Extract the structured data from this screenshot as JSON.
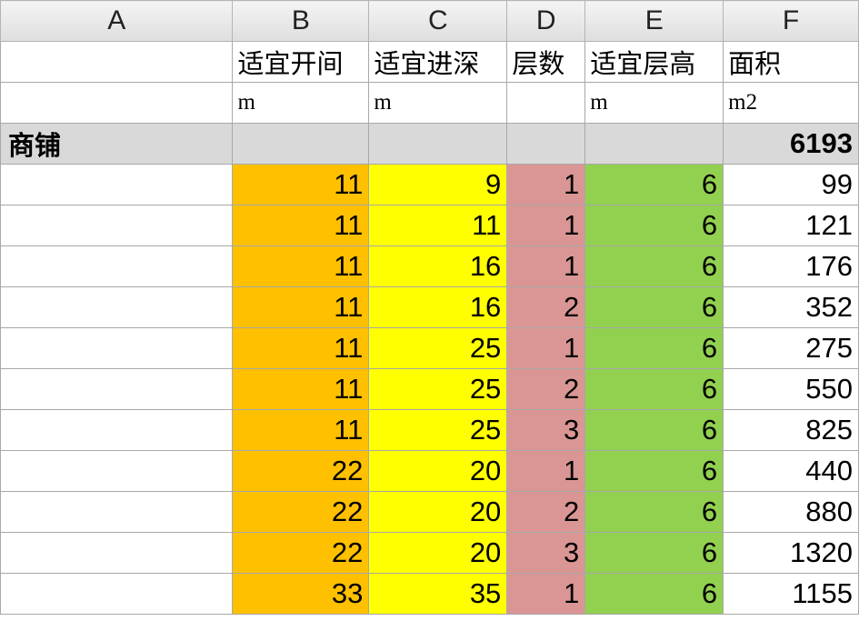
{
  "columns": [
    "A",
    "B",
    "C",
    "D",
    "E",
    "F"
  ],
  "header": [
    "",
    "适宜开间",
    "适宜进深",
    "层数",
    "适宜层高",
    "面积"
  ],
  "units": [
    "",
    "m",
    "m",
    "",
    "m",
    "m2"
  ],
  "section": {
    "label": "商铺",
    "total": "6193"
  },
  "rows": [
    [
      "",
      "11",
      "9",
      "1",
      "6",
      "99"
    ],
    [
      "",
      "11",
      "11",
      "1",
      "6",
      "121"
    ],
    [
      "",
      "11",
      "16",
      "1",
      "6",
      "176"
    ],
    [
      "",
      "11",
      "16",
      "2",
      "6",
      "352"
    ],
    [
      "",
      "11",
      "25",
      "1",
      "6",
      "275"
    ],
    [
      "",
      "11",
      "25",
      "2",
      "6",
      "550"
    ],
    [
      "",
      "11",
      "25",
      "3",
      "6",
      "825"
    ],
    [
      "",
      "22",
      "20",
      "1",
      "6",
      "440"
    ],
    [
      "",
      "22",
      "20",
      "2",
      "6",
      "880"
    ],
    [
      "",
      "22",
      "20",
      "3",
      "6",
      "1320"
    ],
    [
      "",
      "33",
      "35",
      "1",
      "6",
      "1155"
    ]
  ],
  "fill_colors": {
    "B": "#ffc000",
    "C": "#ffff00",
    "D": "#da9694",
    "E": "#92d050",
    "section": "#d9d9d9"
  }
}
